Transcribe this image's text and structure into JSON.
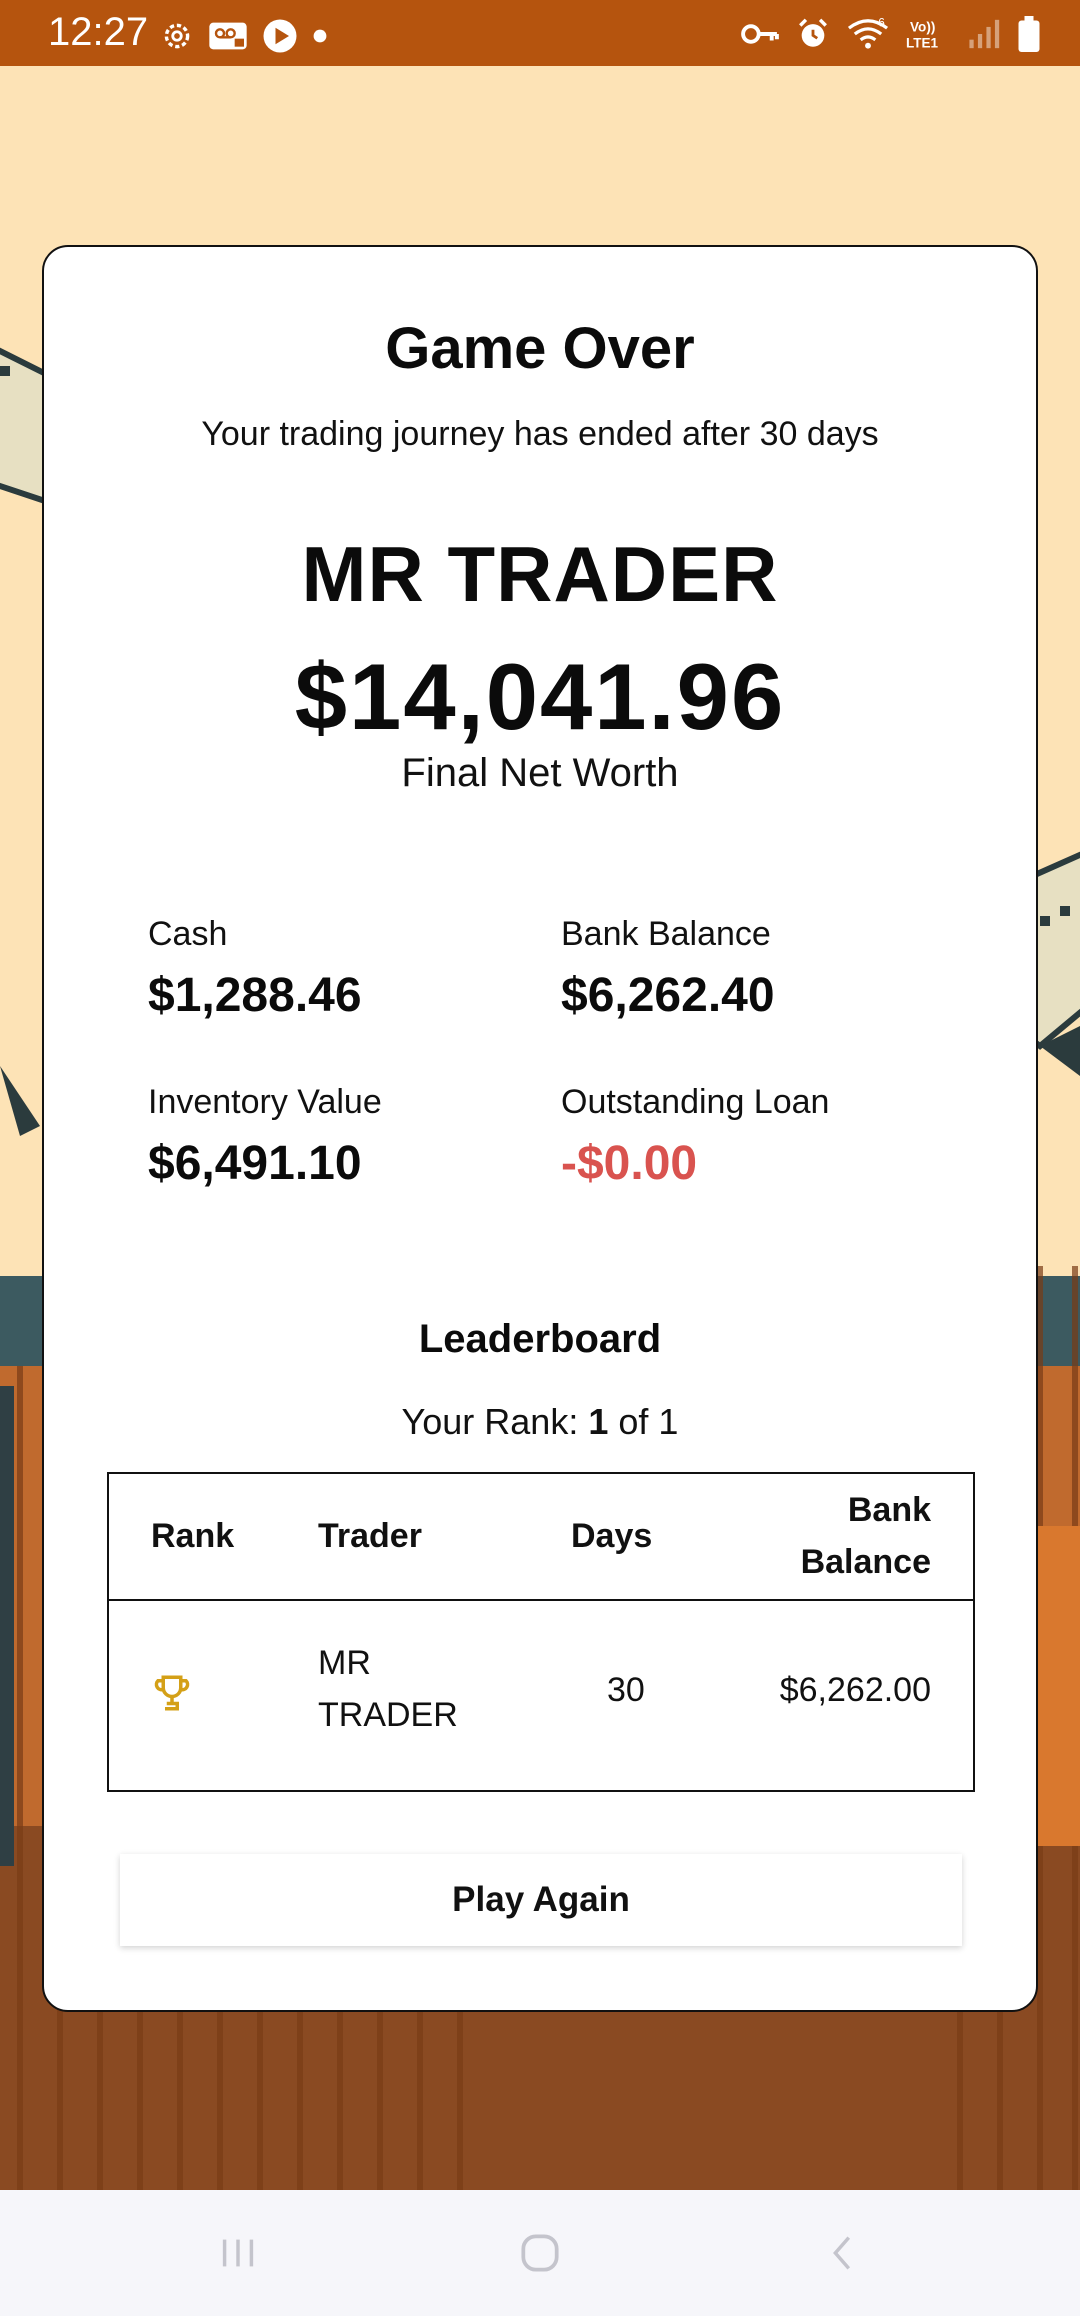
{
  "status_bar": {
    "time": "12:27",
    "left_icons": [
      "settings-icon",
      "voicemail-icon",
      "play-icon",
      "dot-icon"
    ],
    "right_icons": [
      "vpn-key-icon",
      "alarm-icon",
      "wifi-icon",
      "volte-icon",
      "signal-icon",
      "battery-icon"
    ],
    "volte_line1": "Vo))",
    "volte_line2": "LTE1",
    "wifi_badge": "6"
  },
  "game_over": {
    "title": "Game Over",
    "subtitle": "Your trading journey has ended after 30 days",
    "player_name": "MR TRADER",
    "net_worth": "$14,041.96",
    "net_worth_label": "Final Net Worth"
  },
  "stats": {
    "cash_label": "Cash",
    "cash_value": "$1,288.46",
    "bank_label": "Bank Balance",
    "bank_value": "$6,262.40",
    "inventory_label": "Inventory Value",
    "inventory_value": "$6,491.10",
    "loan_label": "Outstanding Loan",
    "loan_value": "-$0.00"
  },
  "leaderboard": {
    "title": "Leaderboard",
    "rank_prefix": "Your Rank: ",
    "rank_value": "1",
    "rank_suffix": " of 1",
    "headers": {
      "rank": "Rank",
      "trader": "Trader",
      "days": "Days",
      "bank_line1": "Bank",
      "bank_line2": "Balance"
    },
    "rows": [
      {
        "rank_icon": "trophy-icon",
        "trader_line1": "MR",
        "trader_line2": "TRADER",
        "days": "30",
        "bank_balance": "$6,262.00"
      }
    ]
  },
  "actions": {
    "play_again": "Play Again"
  },
  "nav": {
    "icons": [
      "recents-icon",
      "home-icon",
      "back-icon"
    ]
  },
  "colors": {
    "status_bar": "#b5540e",
    "background": "#fde3b6",
    "negative": "#d9534f",
    "trophy": "#d4a017"
  }
}
